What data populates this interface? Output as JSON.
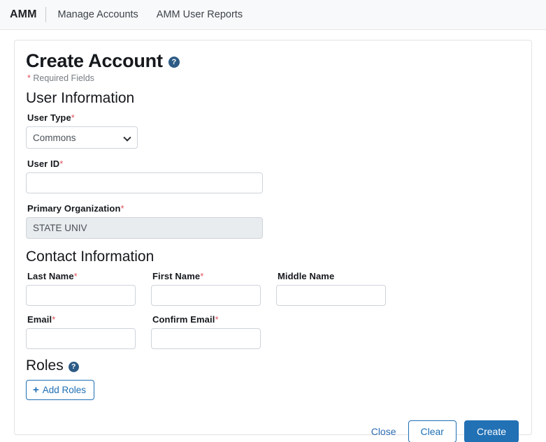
{
  "navbar": {
    "brand": "AMM",
    "links": [
      {
        "label": "Manage Accounts"
      },
      {
        "label": "AMM User Reports"
      }
    ]
  },
  "form": {
    "title": "Create Account",
    "title_help_icon": "help-circle-icon",
    "help_glyph": "?",
    "required_note": "Required Fields",
    "asterisk": "*",
    "sections": {
      "user_information": {
        "heading": "User Information",
        "user_type": {
          "label": "User Type",
          "required": true,
          "value": "Commons",
          "options": [
            "Commons"
          ]
        },
        "user_id": {
          "label": "User ID",
          "required": true,
          "value": "",
          "placeholder": ""
        },
        "primary_organization": {
          "label": "Primary Organization",
          "required": true,
          "value": "STATE UNIV",
          "disabled": true
        }
      },
      "contact_information": {
        "heading": "Contact Information",
        "last_name": {
          "label": "Last Name",
          "required": true,
          "value": "",
          "placeholder": ""
        },
        "first_name": {
          "label": "First Name",
          "required": true,
          "value": "",
          "placeholder": ""
        },
        "middle_name": {
          "label": "Middle Name",
          "required": false,
          "value": "",
          "placeholder": ""
        },
        "email": {
          "label": "Email",
          "required": true,
          "value": "",
          "placeholder": ""
        },
        "confirm_email": {
          "label": "Confirm Email",
          "required": true,
          "value": "",
          "placeholder": ""
        }
      },
      "roles": {
        "heading": "Roles",
        "help_icon": "help-circle-icon",
        "add_button": "Add Roles",
        "add_icon": "plus-icon",
        "add_icon_glyph": "+"
      }
    },
    "actions": {
      "close": "Close",
      "clear": "Clear",
      "create": "Create"
    }
  },
  "colors": {
    "primary": "#2271b5",
    "link": "#2d6cb3",
    "required_asterisk": "#e0525f",
    "help_badge": "#2d5b85",
    "navbar_bg": "#f8f9fa",
    "disabled_field_bg": "#e9ecef",
    "field_border": "#ced4da"
  }
}
